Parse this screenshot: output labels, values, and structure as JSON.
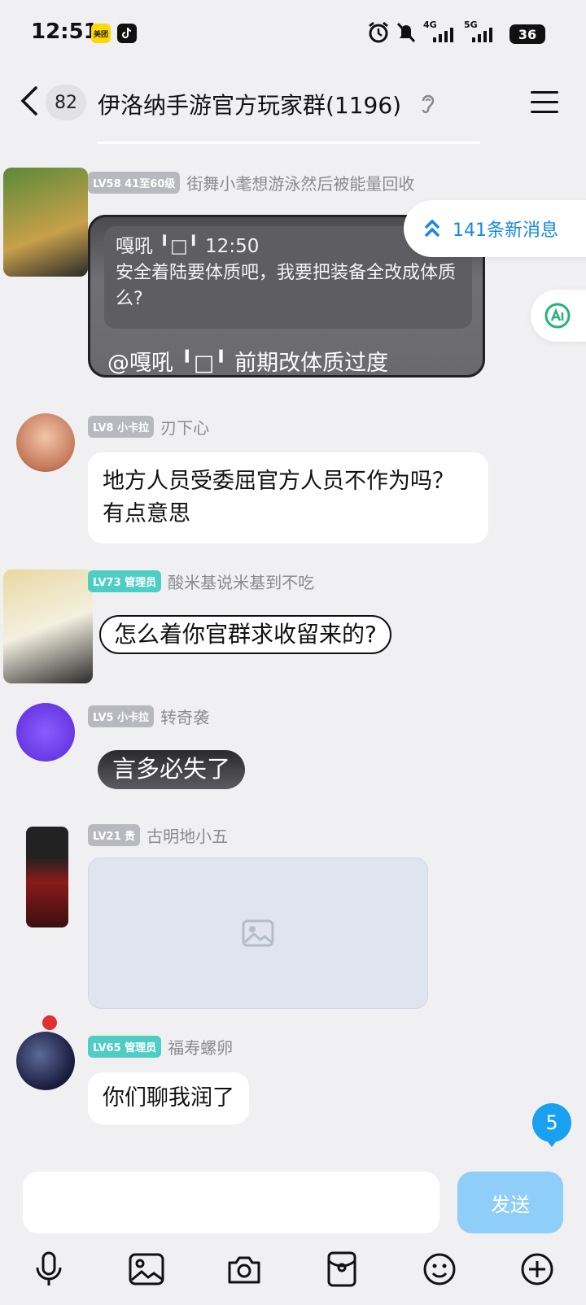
{
  "status_bar": {
    "time": "12:51",
    "app1": "美团",
    "net1": "4G",
    "net2": "5G",
    "battery": "36"
  },
  "header": {
    "unread_count": "82",
    "title": "伊洛纳手游官方玩家群(1196)"
  },
  "new_messages": {
    "label": "141条新消息"
  },
  "messages": [
    {
      "level": "LV58 41至60级",
      "name": "街舞小耄想游泳然后被能量回收",
      "quote_header": "嘎吼 ╹□╹ 12:50",
      "quote_text": "安全着陆要体质吧，我要把装备全改成体质么?",
      "reply": "@嘎吼 ╹□╹ 前期改体质过度"
    },
    {
      "level": "LV8 小卡拉",
      "name": "刃下心",
      "text": "地方人员受委屈官方人员不作为吗？有点意思"
    },
    {
      "level": "LV73 管理员",
      "name": "酸米基说米基到不吃",
      "text": "怎么着你官群求收留来的?"
    },
    {
      "level": "LV5 小卡拉",
      "name": "转奇袭",
      "text": "言多必失了"
    },
    {
      "level": "LV21 贵",
      "name": "古明地小五"
    },
    {
      "level": "LV65 管理员",
      "name": "福寿螺卵",
      "text": "你们聊我润了"
    }
  ],
  "float_badge": "5",
  "composer": {
    "placeholder": "",
    "send_label": "发送"
  },
  "colors": {
    "accent": "#1687e8",
    "admin_tag": "#4ecdc4",
    "send_disabled": "#8fcef8"
  }
}
